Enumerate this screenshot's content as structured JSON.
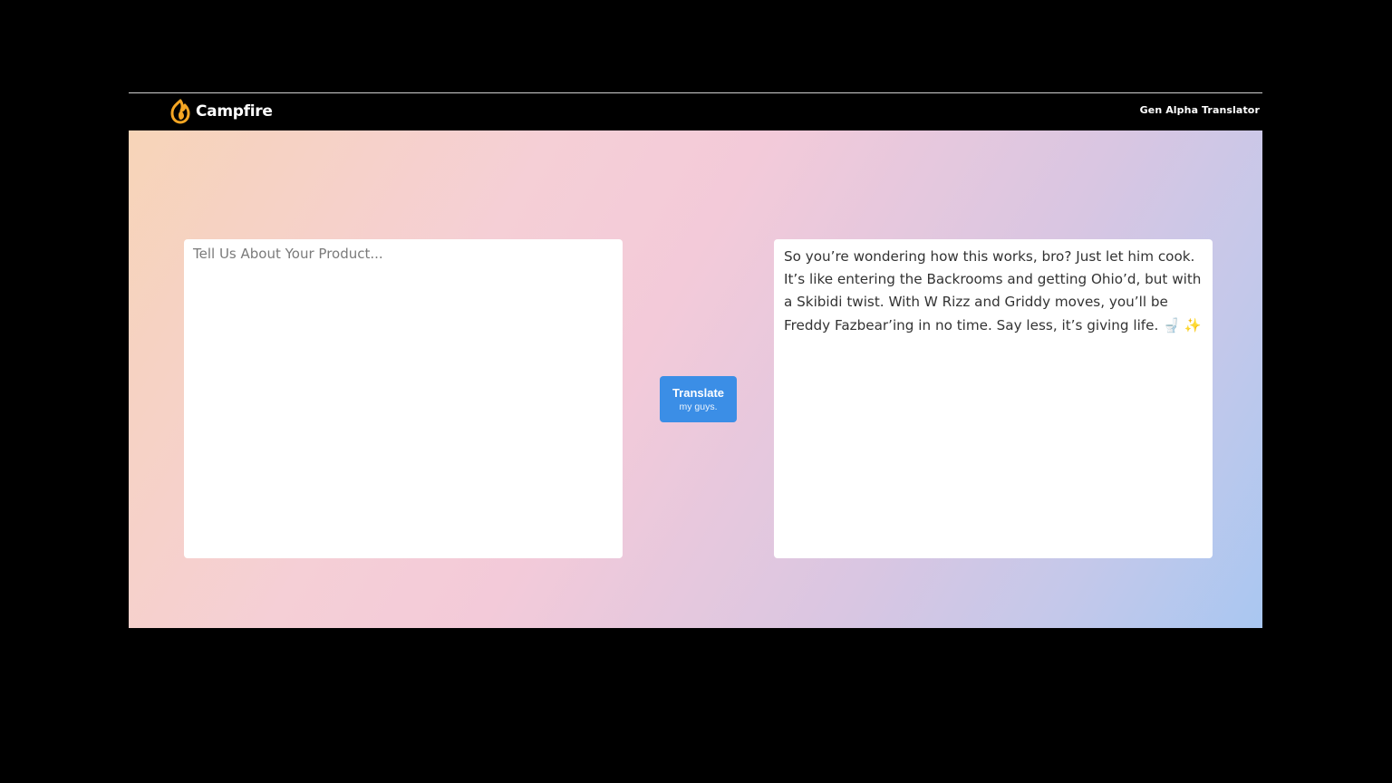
{
  "navbar": {
    "brand_name": "Campfire",
    "brand_icon": "campfire-flame-icon",
    "nav_link": "Gen Alpha Translator"
  },
  "input": {
    "placeholder": "Tell Us About Your Product...",
    "value": ""
  },
  "translate_button": {
    "label": "Translate",
    "sublabel": "my guys."
  },
  "output": {
    "text": "So you’re wondering how this works, bro? Just let him cook. It’s like entering the Backrooms and getting Ohio’d, but with a Skibidi twist. With W Rizz and Griddy moves, you’ll be Freddy Fazbear’ing in no time. Say less, it’s giving life. 🚽 ✨"
  },
  "colors": {
    "navbar_bg": "#000000",
    "brand_accent": "#f5a623",
    "button_bg": "#3b8ee6",
    "gradient_start": "#f7d4b8",
    "gradient_mid": "#f3cad9",
    "gradient_end": "#a9c7f1"
  }
}
